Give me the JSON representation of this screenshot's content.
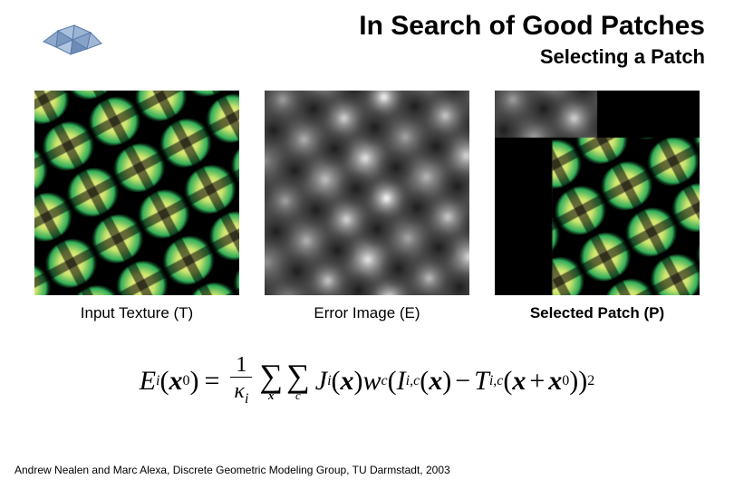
{
  "title": "In Search of Good Patches",
  "subtitle": "Selecting a Patch",
  "captions": {
    "input": "Input Texture (T)",
    "error": "Error Image (E)",
    "selected": "Selected Patch (P)"
  },
  "equation_text": "E_i(x_0) = (1/κ_i) Σ_x Σ_c J_i(x) w_c ( I_{i,c}(x) − T_{i,c}(x + x_0) )^2",
  "footer": "Andrew Nealen and Marc Alexa, Discrete Geometric Modeling Group, TU Darmstadt, 2003"
}
